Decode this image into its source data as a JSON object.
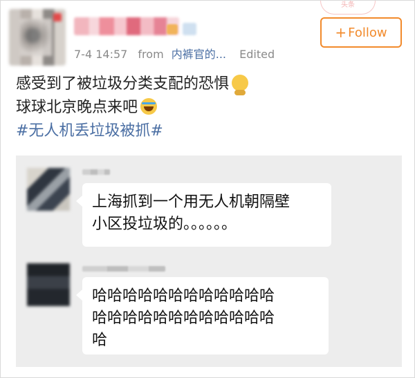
{
  "header": {
    "username": "",
    "timestamp": "7-4 14:57",
    "from_label": "from",
    "source": "内裤官的...",
    "edited_label": "Edited",
    "follow_label": "Follow",
    "follow_plus": "+"
  },
  "post": {
    "line1": "感受到了被垃圾分类支配的恐惧",
    "line2": "球球北京晚点来吧",
    "hashtag": "#无人机丢垃圾被抓#"
  },
  "chat": {
    "messages": [
      {
        "text_line1": "上海抓到一个用无人机朝隔壁",
        "text_line2": "小区投垃圾的。。。。。。"
      },
      {
        "text_line1": "哈哈哈哈哈哈哈哈哈哈哈哈",
        "text_line2": "哈哈哈哈哈哈哈哈哈哈哈哈",
        "text_line3": "哈"
      }
    ]
  },
  "icons": {
    "emoji1": "thinking-face-icon",
    "emoji2": "laughing-tears-icon"
  },
  "colors": {
    "accent": "#f28a2b",
    "link": "#4a6ea3",
    "meta_gray": "#8a8a8a",
    "chat_bg": "#ededed"
  }
}
